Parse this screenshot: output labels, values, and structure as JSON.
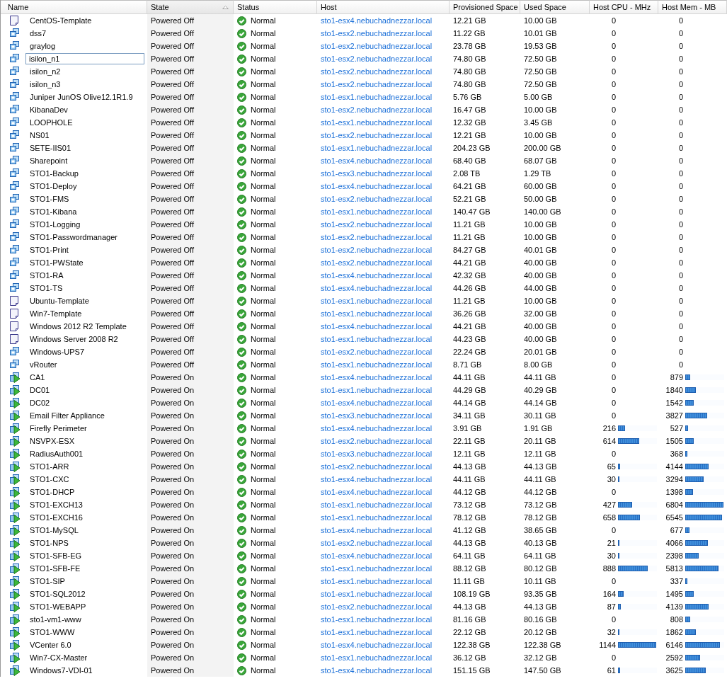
{
  "table": {
    "columns": [
      {
        "label": "Name",
        "sorted": false
      },
      {
        "label": "State",
        "sorted": true
      },
      {
        "label": "Status",
        "sorted": false
      },
      {
        "label": "Host",
        "sorted": false
      },
      {
        "label": "Provisioned Space",
        "sorted": false
      },
      {
        "label": "Used Space",
        "sorted": false
      },
      {
        "label": "Host CPU - MHz",
        "sorted": false
      },
      {
        "label": "Host Mem - MB",
        "sorted": false
      }
    ],
    "rows": [
      {
        "kind": "template",
        "name": "CentOS-Template",
        "editing": false,
        "state": "Powered Off",
        "status": "Normal",
        "host": "sto1-esx4.nebuchadnezzar.local",
        "provisioned": "12.21 GB",
        "used": "10.00 GB",
        "cpu": {
          "value": "0"
        },
        "mem": {
          "value": "0"
        }
      },
      {
        "kind": "vm-off",
        "name": "dss7",
        "editing": false,
        "state": "Powered Off",
        "status": "Normal",
        "host": "sto1-esx2.nebuchadnezzar.local",
        "provisioned": "11.22 GB",
        "used": "10.01 GB",
        "cpu": {
          "value": "0"
        },
        "mem": {
          "value": "0"
        }
      },
      {
        "kind": "vm-off",
        "name": "graylog",
        "editing": false,
        "state": "Powered Off",
        "status": "Normal",
        "host": "sto1-esx2.nebuchadnezzar.local",
        "provisioned": "23.78 GB",
        "used": "19.53 GB",
        "cpu": {
          "value": "0"
        },
        "mem": {
          "value": "0"
        }
      },
      {
        "kind": "vm-off",
        "name": "isilon_n1",
        "editing": true,
        "state": "Powered Off",
        "status": "Normal",
        "host": "sto1-esx2.nebuchadnezzar.local",
        "provisioned": "74.80 GB",
        "used": "72.50 GB",
        "cpu": {
          "value": "0"
        },
        "mem": {
          "value": "0"
        }
      },
      {
        "kind": "vm-off",
        "name": "isilon_n2",
        "editing": false,
        "state": "Powered Off",
        "status": "Normal",
        "host": "sto1-esx2.nebuchadnezzar.local",
        "provisioned": "74.80 GB",
        "used": "72.50 GB",
        "cpu": {
          "value": "0"
        },
        "mem": {
          "value": "0"
        }
      },
      {
        "kind": "vm-off",
        "name": "isilon_n3",
        "editing": false,
        "state": "Powered Off",
        "status": "Normal",
        "host": "sto1-esx2.nebuchadnezzar.local",
        "provisioned": "74.80 GB",
        "used": "72.50 GB",
        "cpu": {
          "value": "0"
        },
        "mem": {
          "value": "0"
        }
      },
      {
        "kind": "vm-off",
        "name": "Juniper JunOS Olive12.1R1.9",
        "editing": false,
        "state": "Powered Off",
        "status": "Normal",
        "host": "sto1-esx1.nebuchadnezzar.local",
        "provisioned": "5.76 GB",
        "used": "5.00 GB",
        "cpu": {
          "value": "0"
        },
        "mem": {
          "value": "0"
        }
      },
      {
        "kind": "vm-off",
        "name": "KibanaDev",
        "editing": false,
        "state": "Powered Off",
        "status": "Normal",
        "host": "sto1-esx2.nebuchadnezzar.local",
        "provisioned": "16.47 GB",
        "used": "10.00 GB",
        "cpu": {
          "value": "0"
        },
        "mem": {
          "value": "0"
        }
      },
      {
        "kind": "vm-off",
        "name": "LOOPHOLE",
        "editing": false,
        "state": "Powered Off",
        "status": "Normal",
        "host": "sto1-esx1.nebuchadnezzar.local",
        "provisioned": "12.32 GB",
        "used": "3.45 GB",
        "cpu": {
          "value": "0"
        },
        "mem": {
          "value": "0"
        }
      },
      {
        "kind": "vm-off",
        "name": "NS01",
        "editing": false,
        "state": "Powered Off",
        "status": "Normal",
        "host": "sto1-esx2.nebuchadnezzar.local",
        "provisioned": "12.21 GB",
        "used": "10.00 GB",
        "cpu": {
          "value": "0"
        },
        "mem": {
          "value": "0"
        }
      },
      {
        "kind": "vm-off",
        "name": "SETE-IIS01",
        "editing": false,
        "state": "Powered Off",
        "status": "Normal",
        "host": "sto1-esx1.nebuchadnezzar.local",
        "provisioned": "204.23 GB",
        "used": "200.00 GB",
        "cpu": {
          "value": "0"
        },
        "mem": {
          "value": "0"
        }
      },
      {
        "kind": "vm-off",
        "name": "Sharepoint",
        "editing": false,
        "state": "Powered Off",
        "status": "Normal",
        "host": "sto1-esx4.nebuchadnezzar.local",
        "provisioned": "68.40 GB",
        "used": "68.07 GB",
        "cpu": {
          "value": "0"
        },
        "mem": {
          "value": "0"
        }
      },
      {
        "kind": "vm-off",
        "name": "STO1-Backup",
        "editing": false,
        "state": "Powered Off",
        "status": "Normal",
        "host": "sto1-esx3.nebuchadnezzar.local",
        "provisioned": "2.08 TB",
        "used": "1.29 TB",
        "cpu": {
          "value": "0"
        },
        "mem": {
          "value": "0"
        }
      },
      {
        "kind": "vm-off",
        "name": "STO1-Deploy",
        "editing": false,
        "state": "Powered Off",
        "status": "Normal",
        "host": "sto1-esx4.nebuchadnezzar.local",
        "provisioned": "64.21 GB",
        "used": "60.00 GB",
        "cpu": {
          "value": "0"
        },
        "mem": {
          "value": "0"
        }
      },
      {
        "kind": "vm-off",
        "name": "STO1-FMS",
        "editing": false,
        "state": "Powered Off",
        "status": "Normal",
        "host": "sto1-esx2.nebuchadnezzar.local",
        "provisioned": "52.21 GB",
        "used": "50.00 GB",
        "cpu": {
          "value": "0"
        },
        "mem": {
          "value": "0"
        }
      },
      {
        "kind": "vm-off",
        "name": "STO1-Kibana",
        "editing": false,
        "state": "Powered Off",
        "status": "Normal",
        "host": "sto1-esx1.nebuchadnezzar.local",
        "provisioned": "140.47 GB",
        "used": "140.00 GB",
        "cpu": {
          "value": "0"
        },
        "mem": {
          "value": "0"
        }
      },
      {
        "kind": "vm-off",
        "name": "STO1-Logging",
        "editing": false,
        "state": "Powered Off",
        "status": "Normal",
        "host": "sto1-esx2.nebuchadnezzar.local",
        "provisioned": "11.21 GB",
        "used": "10.00 GB",
        "cpu": {
          "value": "0"
        },
        "mem": {
          "value": "0"
        }
      },
      {
        "kind": "vm-off",
        "name": "STO1-Passwordmanager",
        "editing": false,
        "state": "Powered Off",
        "status": "Normal",
        "host": "sto1-esx2.nebuchadnezzar.local",
        "provisioned": "11.21 GB",
        "used": "10.00 GB",
        "cpu": {
          "value": "0"
        },
        "mem": {
          "value": "0"
        }
      },
      {
        "kind": "vm-off",
        "name": "STO1-Print",
        "editing": false,
        "state": "Powered Off",
        "status": "Normal",
        "host": "sto1-esx2.nebuchadnezzar.local",
        "provisioned": "84.27 GB",
        "used": "40.01 GB",
        "cpu": {
          "value": "0"
        },
        "mem": {
          "value": "0"
        }
      },
      {
        "kind": "vm-off",
        "name": "STO1-PWState",
        "editing": false,
        "state": "Powered Off",
        "status": "Normal",
        "host": "sto1-esx2.nebuchadnezzar.local",
        "provisioned": "44.21 GB",
        "used": "40.00 GB",
        "cpu": {
          "value": "0"
        },
        "mem": {
          "value": "0"
        }
      },
      {
        "kind": "vm-off",
        "name": "STO1-RA",
        "editing": false,
        "state": "Powered Off",
        "status": "Normal",
        "host": "sto1-esx4.nebuchadnezzar.local",
        "provisioned": "42.32 GB",
        "used": "40.00 GB",
        "cpu": {
          "value": "0"
        },
        "mem": {
          "value": "0"
        }
      },
      {
        "kind": "vm-off",
        "name": "STO1-TS",
        "editing": false,
        "state": "Powered Off",
        "status": "Normal",
        "host": "sto1-esx4.nebuchadnezzar.local",
        "provisioned": "44.26 GB",
        "used": "44.00 GB",
        "cpu": {
          "value": "0"
        },
        "mem": {
          "value": "0"
        }
      },
      {
        "kind": "template",
        "name": "Ubuntu-Template",
        "editing": false,
        "state": "Powered Off",
        "status": "Normal",
        "host": "sto1-esx1.nebuchadnezzar.local",
        "provisioned": "11.21 GB",
        "used": "10.00 GB",
        "cpu": {
          "value": "0"
        },
        "mem": {
          "value": "0"
        }
      },
      {
        "kind": "template",
        "name": "Win7-Template",
        "editing": false,
        "state": "Powered Off",
        "status": "Normal",
        "host": "sto1-esx1.nebuchadnezzar.local",
        "provisioned": "36.26 GB",
        "used": "32.00 GB",
        "cpu": {
          "value": "0"
        },
        "mem": {
          "value": "0"
        }
      },
      {
        "kind": "template",
        "name": "Windows 2012 R2 Template",
        "editing": false,
        "state": "Powered Off",
        "status": "Normal",
        "host": "sto1-esx4.nebuchadnezzar.local",
        "provisioned": "44.21 GB",
        "used": "40.00 GB",
        "cpu": {
          "value": "0"
        },
        "mem": {
          "value": "0"
        }
      },
      {
        "kind": "template",
        "name": "Windows Server 2008 R2",
        "editing": false,
        "state": "Powered Off",
        "status": "Normal",
        "host": "sto1-esx1.nebuchadnezzar.local",
        "provisioned": "44.23 GB",
        "used": "40.00 GB",
        "cpu": {
          "value": "0"
        },
        "mem": {
          "value": "0"
        }
      },
      {
        "kind": "vm-off",
        "name": "Windows-UPS7",
        "editing": false,
        "state": "Powered Off",
        "status": "Normal",
        "host": "sto1-esx2.nebuchadnezzar.local",
        "provisioned": "22.24 GB",
        "used": "20.01 GB",
        "cpu": {
          "value": "0"
        },
        "mem": {
          "value": "0"
        }
      },
      {
        "kind": "vm-off",
        "name": "vRouter",
        "editing": false,
        "state": "Powered Off",
        "status": "Normal",
        "host": "sto1-esx1.nebuchadnezzar.local",
        "provisioned": "8.71 GB",
        "used": "8.00 GB",
        "cpu": {
          "value": "0"
        },
        "mem": {
          "value": "0"
        }
      },
      {
        "kind": "vm-on",
        "name": "CA1",
        "editing": false,
        "state": "Powered On",
        "status": "Normal",
        "host": "sto1-esx4.nebuchadnezzar.local",
        "provisioned": "44.11 GB",
        "used": "44.11 GB",
        "cpu": {
          "value": "0"
        },
        "mem": {
          "value": "879",
          "level": 0.13
        }
      },
      {
        "kind": "vm-on",
        "name": "DC01",
        "editing": false,
        "state": "Powered On",
        "status": "Normal",
        "host": "sto1-esx1.nebuchadnezzar.local",
        "provisioned": "44.29 GB",
        "used": "40.29 GB",
        "cpu": {
          "value": "0"
        },
        "mem": {
          "value": "1840",
          "level": 0.27
        }
      },
      {
        "kind": "vm-on",
        "name": "DC02",
        "editing": false,
        "state": "Powered On",
        "status": "Normal",
        "host": "sto1-esx4.nebuchadnezzar.local",
        "provisioned": "44.14 GB",
        "used": "44.14 GB",
        "cpu": {
          "value": "0"
        },
        "mem": {
          "value": "1542",
          "level": 0.22
        }
      },
      {
        "kind": "vm-on",
        "name": "Email Filter Appliance",
        "editing": false,
        "state": "Powered On",
        "status": "Normal",
        "host": "sto1-esx3.nebuchadnezzar.local",
        "provisioned": "34.11 GB",
        "used": "30.11 GB",
        "cpu": {
          "value": "0"
        },
        "mem": {
          "value": "3827",
          "level": 0.56
        }
      },
      {
        "kind": "vm-on",
        "name": "Firefly Perimeter",
        "editing": false,
        "state": "Powered On",
        "status": "Normal",
        "host": "sto1-esx4.nebuchadnezzar.local",
        "provisioned": "3.91 GB",
        "used": "1.91 GB",
        "cpu": {
          "value": "216",
          "level": 0.19
        },
        "mem": {
          "value": "527",
          "level": 0.08
        }
      },
      {
        "kind": "vm-on",
        "name": "NSVPX-ESX",
        "editing": false,
        "state": "Powered On",
        "status": "Normal",
        "host": "sto1-esx2.nebuchadnezzar.local",
        "provisioned": "22.11 GB",
        "used": "20.11 GB",
        "cpu": {
          "value": "614",
          "level": 0.54
        },
        "mem": {
          "value": "1505",
          "level": 0.22
        }
      },
      {
        "kind": "vm-on",
        "name": "RadiusAuth001",
        "editing": false,
        "state": "Powered On",
        "status": "Normal",
        "host": "sto1-esx3.nebuchadnezzar.local",
        "provisioned": "12.11 GB",
        "used": "12.11 GB",
        "cpu": {
          "value": "0"
        },
        "mem": {
          "value": "368",
          "level": 0.05
        }
      },
      {
        "kind": "vm-on",
        "name": "STO1-ARR",
        "editing": false,
        "state": "Powered On",
        "status": "Normal",
        "host": "sto1-esx2.nebuchadnezzar.local",
        "provisioned": "44.13 GB",
        "used": "44.13 GB",
        "cpu": {
          "value": "65",
          "level": 0.06
        },
        "mem": {
          "value": "4144",
          "level": 0.6
        }
      },
      {
        "kind": "vm-on",
        "name": "STO1-CXC",
        "editing": false,
        "state": "Powered On",
        "status": "Normal",
        "host": "sto1-esx4.nebuchadnezzar.local",
        "provisioned": "44.11 GB",
        "used": "44.11 GB",
        "cpu": {
          "value": "30",
          "level": 0.03
        },
        "mem": {
          "value": "3294",
          "level": 0.48
        }
      },
      {
        "kind": "vm-on",
        "name": "STO1-DHCP",
        "editing": false,
        "state": "Powered On",
        "status": "Normal",
        "host": "sto1-esx4.nebuchadnezzar.local",
        "provisioned": "44.12 GB",
        "used": "44.12 GB",
        "cpu": {
          "value": "0"
        },
        "mem": {
          "value": "1398",
          "level": 0.2
        }
      },
      {
        "kind": "vm-on",
        "name": "STO1-EXCH13",
        "editing": false,
        "state": "Powered On",
        "status": "Normal",
        "host": "sto1-esx1.nebuchadnezzar.local",
        "provisioned": "73.12 GB",
        "used": "73.12 GB",
        "cpu": {
          "value": "427",
          "level": 0.37
        },
        "mem": {
          "value": "6804",
          "level": 0.99
        }
      },
      {
        "kind": "vm-on",
        "name": "STO1-EXCH16",
        "editing": false,
        "state": "Powered On",
        "status": "Normal",
        "host": "sto1-esx1.nebuchadnezzar.local",
        "provisioned": "78.12 GB",
        "used": "78.12 GB",
        "cpu": {
          "value": "658",
          "level": 0.57
        },
        "mem": {
          "value": "6545",
          "level": 0.95
        }
      },
      {
        "kind": "vm-on",
        "name": "STO1-MySQL",
        "editing": false,
        "state": "Powered On",
        "status": "Normal",
        "host": "sto1-esx4.nebuchadnezzar.local",
        "provisioned": "41.12 GB",
        "used": "38.65 GB",
        "cpu": {
          "value": "0"
        },
        "mem": {
          "value": "677",
          "level": 0.1
        }
      },
      {
        "kind": "vm-on",
        "name": "STO1-NPS",
        "editing": false,
        "state": "Powered On",
        "status": "Normal",
        "host": "sto1-esx2.nebuchadnezzar.local",
        "provisioned": "44.13 GB",
        "used": "40.13 GB",
        "cpu": {
          "value": "21",
          "level": 0.02
        },
        "mem": {
          "value": "4066",
          "level": 0.59
        }
      },
      {
        "kind": "vm-on",
        "name": "STO1-SFB-EG",
        "editing": false,
        "state": "Powered On",
        "status": "Normal",
        "host": "sto1-esx4.nebuchadnezzar.local",
        "provisioned": "64.11 GB",
        "used": "64.11 GB",
        "cpu": {
          "value": "30",
          "level": 0.03
        },
        "mem": {
          "value": "2398",
          "level": 0.35
        }
      },
      {
        "kind": "vm-on",
        "name": "STO1-SFB-FE",
        "editing": false,
        "state": "Powered On",
        "status": "Normal",
        "host": "sto1-esx1.nebuchadnezzar.local",
        "provisioned": "88.12 GB",
        "used": "80.12 GB",
        "cpu": {
          "value": "888",
          "level": 0.77
        },
        "mem": {
          "value": "5813",
          "level": 0.85
        }
      },
      {
        "kind": "vm-on",
        "name": "STO1-SIP",
        "editing": false,
        "state": "Powered On",
        "status": "Normal",
        "host": "sto1-esx1.nebuchadnezzar.local",
        "provisioned": "11.11 GB",
        "used": "10.11 GB",
        "cpu": {
          "value": "0"
        },
        "mem": {
          "value": "337",
          "level": 0.05
        }
      },
      {
        "kind": "vm-on",
        "name": "STO1-SQL2012",
        "editing": false,
        "state": "Powered On",
        "status": "Normal",
        "host": "sto1-esx1.nebuchadnezzar.local",
        "provisioned": "108.19 GB",
        "used": "93.35 GB",
        "cpu": {
          "value": "164",
          "level": 0.14
        },
        "mem": {
          "value": "1495",
          "level": 0.22
        }
      },
      {
        "kind": "vm-on",
        "name": "STO1-WEBAPP",
        "editing": false,
        "state": "Powered On",
        "status": "Normal",
        "host": "sto1-esx2.nebuchadnezzar.local",
        "provisioned": "44.13 GB",
        "used": "44.13 GB",
        "cpu": {
          "value": "87",
          "level": 0.08
        },
        "mem": {
          "value": "4139",
          "level": 0.6
        }
      },
      {
        "kind": "vm-on",
        "name": "sto1-vm1-www",
        "editing": false,
        "state": "Powered On",
        "status": "Normal",
        "host": "sto1-esx1.nebuchadnezzar.local",
        "provisioned": "81.16 GB",
        "used": "80.16 GB",
        "cpu": {
          "value": "0"
        },
        "mem": {
          "value": "808",
          "level": 0.12
        }
      },
      {
        "kind": "vm-on",
        "name": "STO1-WWW",
        "editing": false,
        "state": "Powered On",
        "status": "Normal",
        "host": "sto1-esx1.nebuchadnezzar.local",
        "provisioned": "22.12 GB",
        "used": "20.12 GB",
        "cpu": {
          "value": "32",
          "level": 0.03
        },
        "mem": {
          "value": "1862",
          "level": 0.27
        }
      },
      {
        "kind": "vm-on",
        "name": "VCenter 6.0",
        "editing": false,
        "state": "Powered On",
        "status": "Normal",
        "host": "sto1-esx4.nebuchadnezzar.local",
        "provisioned": "122.38 GB",
        "used": "122.38 GB",
        "cpu": {
          "value": "1144",
          "level": 0.98
        },
        "mem": {
          "value": "6146",
          "level": 0.89
        }
      },
      {
        "kind": "vm-on",
        "name": "Win7-CX-Master",
        "editing": false,
        "state": "Powered On",
        "status": "Normal",
        "host": "sto1-esx1.nebuchadnezzar.local",
        "provisioned": "36.12 GB",
        "used": "32.12 GB",
        "cpu": {
          "value": "0"
        },
        "mem": {
          "value": "2592",
          "level": 0.38
        }
      },
      {
        "kind": "vm-on",
        "name": "Windows7-VDI-01",
        "editing": false,
        "state": "Powered On",
        "status": "Normal",
        "host": "sto1-esx4.nebuchadnezzar.local",
        "provisioned": "151.15 GB",
        "used": "147.50 GB",
        "cpu": {
          "value": "61",
          "level": 0.05
        },
        "mem": {
          "value": "3625",
          "level": 0.53
        }
      }
    ]
  }
}
